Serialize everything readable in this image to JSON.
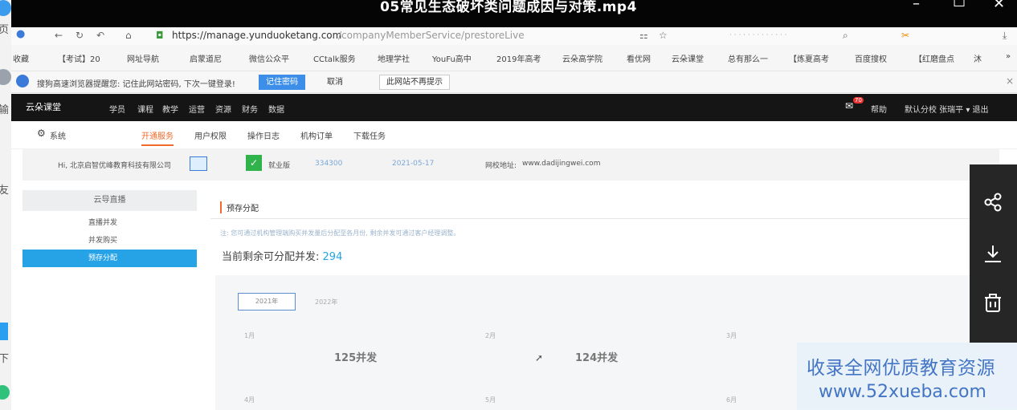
{
  "video": {
    "title": "05常见生态破坏类问题成因与对策.mp4",
    "minimize": "–",
    "maximize": "☐",
    "close": "✕"
  },
  "left_strip": [
    "页",
    "输",
    "友",
    "下"
  ],
  "browser": {
    "url_host": "https://manage.yunduoketang.com",
    "url_path": "/companyMemberService/prestoreLive",
    "bookmarks": [
      "收藏",
      "【考试】20",
      "网址导航",
      "启蒙道尼",
      "微信公众平",
      "CCtalk服务",
      "地理学社",
      "YouFu高中",
      "2019年高考",
      "云朵高学院",
      "看优网",
      "云朵课堂",
      "总有那么一",
      "【炼夏高考",
      "百度搜权",
      "【红磨盘点",
      "沐"
    ],
    "password_prompt": {
      "text": "搜狗高速浏览器提醒您: 记住此网站密码, 下次一键登录!",
      "remember": "记住密码",
      "cancel": "取消",
      "never": "此网站不再提示"
    }
  },
  "app": {
    "brand": "云朵课堂",
    "nav": [
      "学员",
      "课程",
      "教学",
      "运营",
      "资源",
      "财务",
      "数据"
    ],
    "help": "帮助",
    "user": "默认分校 张瑞平 ▾ 退出",
    "badge": "70",
    "subnav": {
      "system": "系统",
      "tabs": [
        "开通服务",
        "用户权限",
        "操作日志",
        "机构订单",
        "下载任务"
      ]
    },
    "info": {
      "greeting": "Hi, 北京启智优峰教育科技有限公司",
      "vip_label": "就业版",
      "org_id": "334300",
      "date": "2021-05-17",
      "site_label": "网校地址:",
      "site_url": "www.dadijingwei.com"
    },
    "sidebar": {
      "head": "云导直播",
      "items": [
        "直播并发",
        "并发购买",
        "预存分配"
      ],
      "active_index": 2
    },
    "main": {
      "title": "预存分配",
      "tip": "注: 您可通过机构管理端购买并发量后分配至各月份, 剩余并发可通过客户经理调整。",
      "remain_label": "当前剩余可分配并发:",
      "remain_value": "294",
      "year_button": "2021年",
      "year_next": "2022年",
      "months": [
        {
          "label": "1月",
          "value": "125并发"
        },
        {
          "label": "2月",
          "value": "124并发"
        },
        {
          "label": "3月",
          "value": ""
        },
        {
          "label": "4月",
          "value": ""
        },
        {
          "label": "5月",
          "value": ""
        },
        {
          "label": "6月",
          "value": ""
        }
      ]
    }
  },
  "watermark": {
    "line1": "收录全网优质教育资源",
    "line2": "www.52xueba.com"
  },
  "colors": {
    "accent": "#26a3e6",
    "title_bar": "#050505",
    "app_nav": "#151515",
    "watermark_text": "#3a6fc2"
  }
}
